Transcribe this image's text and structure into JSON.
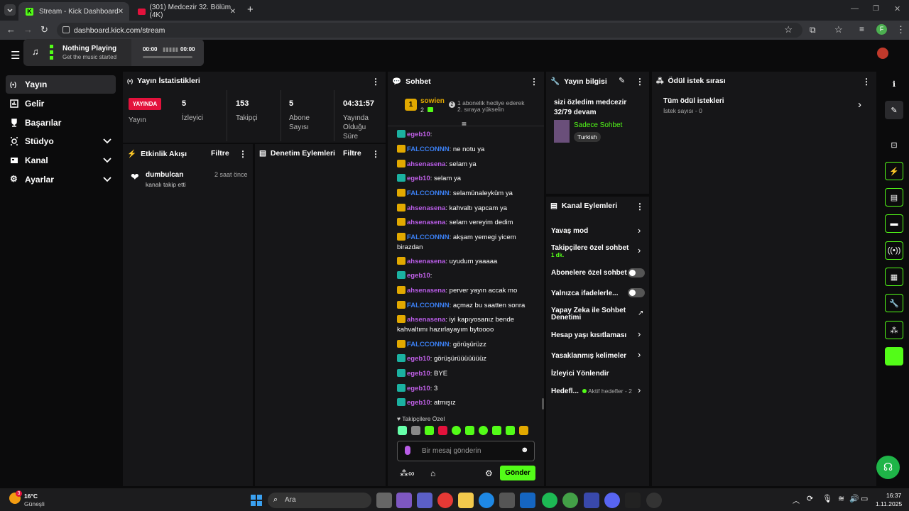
{
  "browser": {
    "tabs": [
      {
        "title": "Stream - Kick Dashboard",
        "active": true
      },
      {
        "title": "(301) Medcezir 32. Bölüm (4K)",
        "active": false
      }
    ],
    "url": "dashboard.kick.com/stream",
    "profile_initial": "F"
  },
  "music": {
    "title": "Nothing Playing",
    "subtitle": "Get the music started",
    "time_start": "00:00",
    "time_end": "00:00"
  },
  "sidebar": {
    "items": [
      {
        "label": "Yayın",
        "icon": "broadcast-icon",
        "active": true
      },
      {
        "label": "Gelir",
        "icon": "revenue-icon"
      },
      {
        "label": "Başarılar",
        "icon": "trophy-icon"
      },
      {
        "label": "Stüdyo",
        "icon": "studio-icon",
        "expandable": true
      },
      {
        "label": "Kanal",
        "icon": "channel-icon",
        "expandable": true
      },
      {
        "label": "Ayarlar",
        "icon": "gear-icon",
        "expandable": true
      }
    ]
  },
  "stats": {
    "title": "Yayın İstatistikleri",
    "live_badge": "YAYINDA",
    "status_label": "Yayın",
    "viewers_value": "5",
    "viewers_label": "İzleyici",
    "followers_value": "153",
    "followers_label": "Takipçi",
    "subs_value": "5",
    "subs_label": "Abone Sayısı",
    "duration_value": "04:31:57",
    "duration_label": "Yayında Olduğu Süre"
  },
  "activity": {
    "title": "Etkinlik Akışı",
    "filter": "Filtre",
    "event_user": "dumbulcan",
    "event_time": "2 saat önce",
    "event_text": "kanalı takip etti"
  },
  "moderation": {
    "title": "Denetim Eylemleri",
    "filter": "Filtre"
  },
  "chat": {
    "title": "Sohbet",
    "pinned_rank": "1",
    "pinned_user": "sowien",
    "pinned_count": "2",
    "pinned_note_line1": "1 abonelik hediye ederek",
    "pinned_note_line2": "2. sıraya yükselin",
    "messages": [
      {
        "user": "egeb10",
        "text": ":",
        "badge": "green",
        "color": "#c060e8"
      },
      {
        "user": "FALCCONNN",
        "text": ": ne notu ya",
        "badge": "crown",
        "color": "#3b7ff2"
      },
      {
        "user": "ahsenasena",
        "text": ": selam ya",
        "badge": "crown",
        "color": "#b85ce6"
      },
      {
        "user": "egeb10",
        "text": ": selam ya",
        "badge": "green",
        "color": "#c060e8"
      },
      {
        "user": "FALCCONNN",
        "text": ": selamünaleyküm ya",
        "badge": "crown",
        "color": "#3b7ff2"
      },
      {
        "user": "ahsenasena",
        "text": ": kahvaltı yapcam ya",
        "badge": "crown",
        "color": "#b85ce6"
      },
      {
        "user": "ahsenasena",
        "text": ": selam vereyim dedim",
        "badge": "crown",
        "color": "#b85ce6"
      },
      {
        "user": "FALCCONNN",
        "text": ": akşam yemegi yicem birazdan",
        "badge": "crown",
        "color": "#3b7ff2"
      },
      {
        "user": "ahsenasena",
        "text": ": uyudum yaaaaa",
        "badge": "crown",
        "color": "#b85ce6"
      },
      {
        "user": "egeb10",
        "text": ":",
        "badge": "green",
        "color": "#c060e8"
      },
      {
        "user": "ahsenasena",
        "text": ": perver yayın accak mo",
        "badge": "crown",
        "color": "#b85ce6"
      },
      {
        "user": "FALCCONNN",
        "text": ": açmaz bu saatten sonra",
        "badge": "crown",
        "color": "#3b7ff2"
      },
      {
        "user": "ahsenasena",
        "text": ": iyi kapıyosanız bende kahvaltımı hazırlayayım bytoooo",
        "badge": "crown",
        "color": "#b85ce6"
      },
      {
        "user": "FALCCONNN",
        "text": ": görüşürüzz",
        "badge": "crown",
        "color": "#3b7ff2"
      },
      {
        "user": "egeb10",
        "text": ": görüşürüüüüüüüz",
        "badge": "green",
        "color": "#c060e8"
      },
      {
        "user": "egeb10",
        "text": ": BYE",
        "badge": "green",
        "color": "#c060e8"
      },
      {
        "user": "egeb10",
        "text": ": 3",
        "badge": "green",
        "color": "#c060e8"
      },
      {
        "user": "egeb10",
        "text": ": atmışız",
        "badge": "green",
        "color": "#c060e8"
      }
    ],
    "emote_section": "Takipçilere Özel",
    "input_placeholder": "Bir mesaj gönderin",
    "send_label": "Gönder"
  },
  "stream_info": {
    "title": "Yayın bilgisi",
    "stream_title": "sizi özledim medcezir 32/79 devam",
    "category": "Sadece Sohbet",
    "language_tag": "Turkish"
  },
  "channel_actions": {
    "title": "Kanal Eylemleri",
    "items": [
      {
        "label": "Yavaş mod"
      },
      {
        "label": "Takipçilere özel sohbet",
        "sub": "1 dk."
      },
      {
        "label": "Abonelere özel sohbet"
      },
      {
        "label": "Yalnızca ifadelerle..."
      },
      {
        "label": "Yapay Zeka ile Sohbet Denetimi"
      },
      {
        "label": "Hesap yaşı kısıtlaması"
      },
      {
        "label": "Yasaklanmış kelimeler"
      },
      {
        "label": "İzleyici Yönlendir"
      },
      {
        "label": "Hedefl...",
        "sub": "Aktif hedefler - 2"
      }
    ]
  },
  "rewards": {
    "title": "Ödül istek sırası",
    "all_label": "Tüm ödül istekleri",
    "count_label": "İstek sayısı - 0"
  },
  "taskbar": {
    "weather_temp": "16°C",
    "weather_text": "Güneşli",
    "weather_badge": "3",
    "search_placeholder": "Ara",
    "time": "16:37",
    "date": "1.11.2025"
  },
  "colors": {
    "accent": "#53fc18",
    "live": "#e3123c",
    "panel": "#161618"
  }
}
